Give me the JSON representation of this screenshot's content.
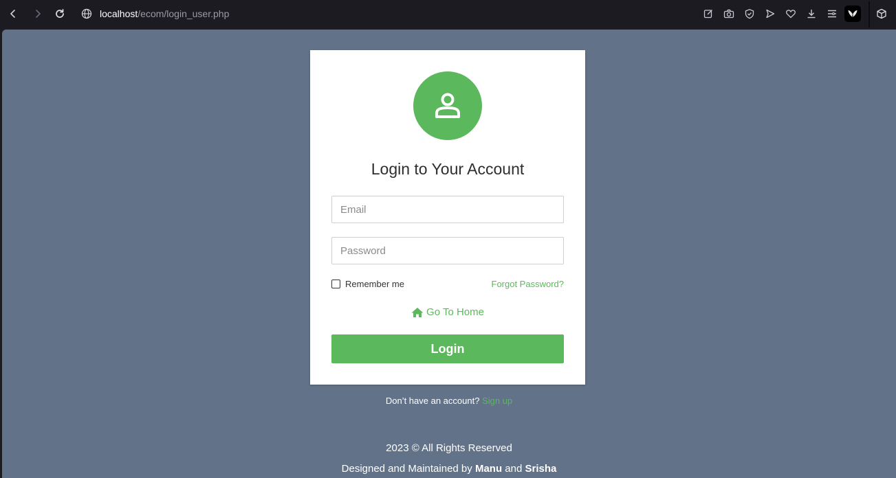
{
  "browser": {
    "url_host": "localhost",
    "url_path": "/ecom/login_user.php"
  },
  "login": {
    "title": "Login to Your Account",
    "email_placeholder": "Email",
    "password_placeholder": "Password",
    "remember_label": "Remember me",
    "forgot_label": "Forgot Password?",
    "home_label": "Go To Home",
    "login_button": "Login",
    "signup_prompt": "Don’t have an account?",
    "signup_link": "Sign up"
  },
  "footer": {
    "rights": "2023 © All Rights Reserved",
    "designed_prefix": "Designed and Maintained by",
    "author1": "Manu",
    "and": "and",
    "author2": "Srisha"
  },
  "colors": {
    "accent": "#5cb85c",
    "page_bg": "#627288",
    "chrome_bg": "#1c1b22"
  },
  "icons": [
    "back-icon",
    "forward-icon",
    "reload-icon",
    "globe-icon",
    "edit-icon",
    "camera-icon",
    "shield-icon",
    "send-icon",
    "heart-icon",
    "download-icon",
    "menu-icon",
    "extension-icon",
    "box-icon",
    "user-icon",
    "home-icon"
  ]
}
